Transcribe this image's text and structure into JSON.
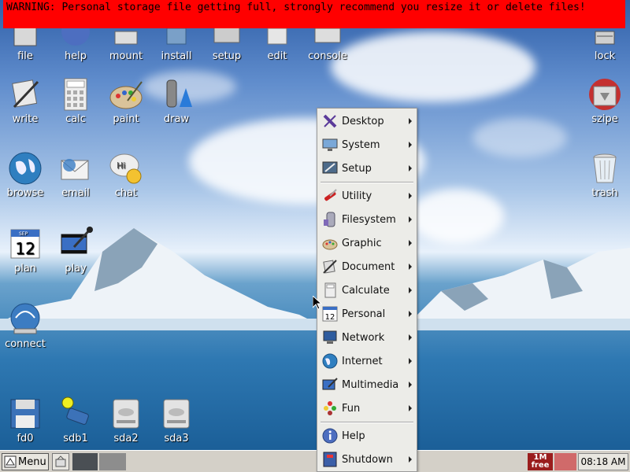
{
  "warning": "WARNING: Personal storage file getting full, strongly recommend you resize it or delete files!",
  "desktop_icons": {
    "file": "file",
    "help": "help",
    "mount": "mount",
    "install": "install",
    "setup": "setup",
    "edit": "edit",
    "console": "console",
    "lock": "lock",
    "write": "write",
    "calc": "calc",
    "paint": "paint",
    "draw": "draw",
    "szipe": "szipe",
    "browse": "browse",
    "email": "email",
    "chat": "chat",
    "trash": "trash",
    "plan": "plan",
    "plan_day": "12",
    "plan_month": "SEP",
    "play": "play",
    "connect": "connect",
    "fd0": "fd0",
    "sdb1": "sdb1",
    "sda2": "sda2",
    "sda3": "sda3"
  },
  "menu": {
    "items": [
      {
        "label": "Desktop",
        "icon": "x-desktop-icon"
      },
      {
        "label": "System",
        "icon": "monitor-icon"
      },
      {
        "label": "Setup",
        "icon": "setup-icon"
      },
      {
        "label": "Utility",
        "icon": "swiss-knife-icon"
      },
      {
        "label": "Filesystem",
        "icon": "folder-icon"
      },
      {
        "label": "Graphic",
        "icon": "palette-icon"
      },
      {
        "label": "Document",
        "icon": "pen-icon"
      },
      {
        "label": "Calculate",
        "icon": "calculator-icon"
      },
      {
        "label": "Personal",
        "icon": "calendar-icon"
      },
      {
        "label": "Network",
        "icon": "network-icon"
      },
      {
        "label": "Internet",
        "icon": "globe-icon"
      },
      {
        "label": "Multimedia",
        "icon": "film-icon"
      },
      {
        "label": "Fun",
        "icon": "fun-icon"
      },
      {
        "label": "Help",
        "icon": "info-icon"
      },
      {
        "label": "Shutdown",
        "icon": "shutdown-icon"
      }
    ],
    "personal_day": "12"
  },
  "taskbar": {
    "menu_label": "Menu",
    "free_top": "1M",
    "free_bottom": "free",
    "clock": "08:18 AM"
  },
  "colors": {
    "warning_bg": "#ff0000",
    "menu_bg": "#ecece8",
    "taskbar_bg": "#d4d0c8"
  }
}
